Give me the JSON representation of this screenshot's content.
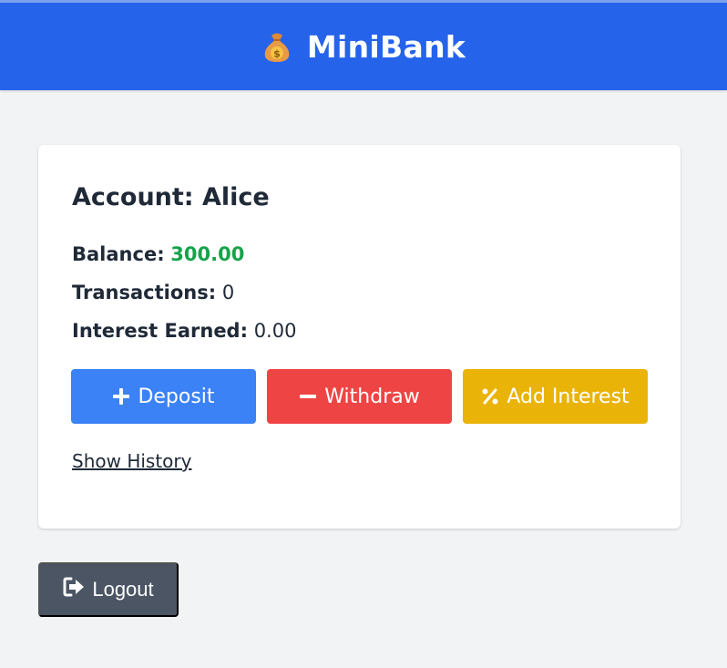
{
  "header": {
    "title": "MiniBank",
    "icon": "money-bag-icon",
    "background": "#2563eb"
  },
  "account": {
    "title": "Account: Alice",
    "balance_label": "Balance:",
    "balance_value": "300.00",
    "balance_color": "#16a34a",
    "transactions_label": "Transactions:",
    "transactions_value": "0",
    "interest_label": "Interest Earned:",
    "interest_value": "0.00"
  },
  "actions": {
    "deposit_label": "Deposit",
    "deposit_icon": "plus-icon",
    "deposit_color": "#3b82f6",
    "withdraw_label": "Withdraw",
    "withdraw_icon": "minus-icon",
    "withdraw_color": "#ef4444",
    "interest_label": "Add Interest",
    "interest_icon": "percent-icon",
    "interest_color": "#eab308"
  },
  "history_link": "Show History",
  "logout": {
    "label": "Logout",
    "icon": "sign-out-icon",
    "color": "#4b5563"
  }
}
